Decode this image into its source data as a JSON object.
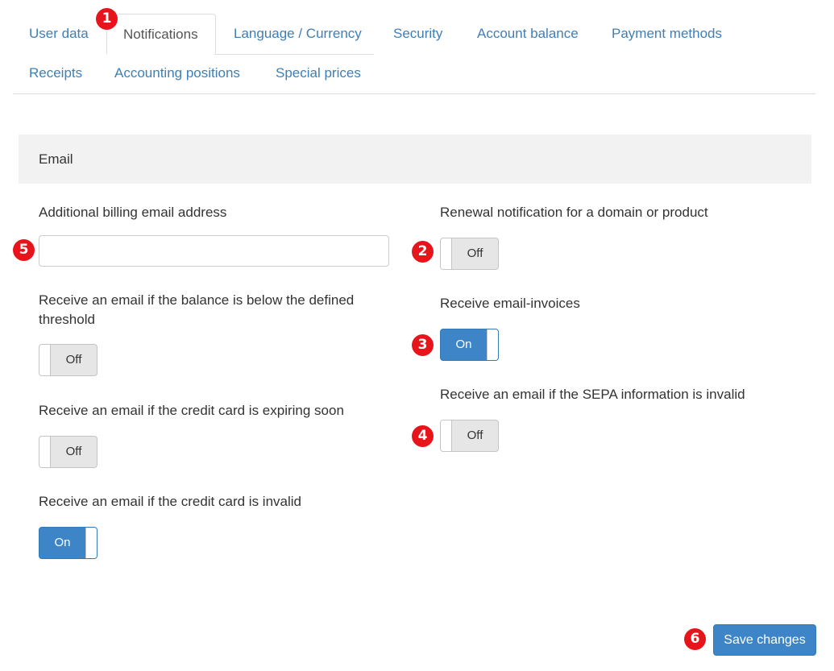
{
  "tabs": [
    {
      "label": "User data",
      "active": false
    },
    {
      "label": "Notifications",
      "active": true
    },
    {
      "label": "Language / Currency",
      "active": false
    },
    {
      "label": "Security",
      "active": false
    },
    {
      "label": "Account balance",
      "active": false
    },
    {
      "label": "Payment methods",
      "active": false
    },
    {
      "label": "Receipts",
      "active": false
    },
    {
      "label": "Accounting positions",
      "active": false
    },
    {
      "label": "Special prices",
      "active": false
    }
  ],
  "section": {
    "title": "Email"
  },
  "left": {
    "billing_email": {
      "label": "Additional billing email address",
      "value": "",
      "placeholder": ""
    },
    "balance_threshold": {
      "label": "Receive an email if the balance is below the defined threshold",
      "state": "Off"
    },
    "cc_expiring": {
      "label": "Receive an email if the credit card is expiring soon",
      "state": "Off"
    },
    "cc_invalid": {
      "label": "Receive an email if the credit card is invalid",
      "state": "On"
    }
  },
  "right": {
    "renewal": {
      "label": "Renewal notification for a domain or product",
      "state": "Off"
    },
    "email_invoices": {
      "label": "Receive email-invoices",
      "state": "On"
    },
    "sepa_invalid": {
      "label": "Receive an email if the SEPA information is invalid",
      "state": "Off"
    }
  },
  "save_label": "Save changes",
  "markers": [
    "1",
    "2",
    "3",
    "4",
    "5",
    "6"
  ],
  "colors": {
    "accent": "#3d85c6",
    "link": "#3f7fb5",
    "marker": "#e8141c",
    "toggle_off": "#e6e6e6",
    "section_bg": "#f2f2f2"
  }
}
